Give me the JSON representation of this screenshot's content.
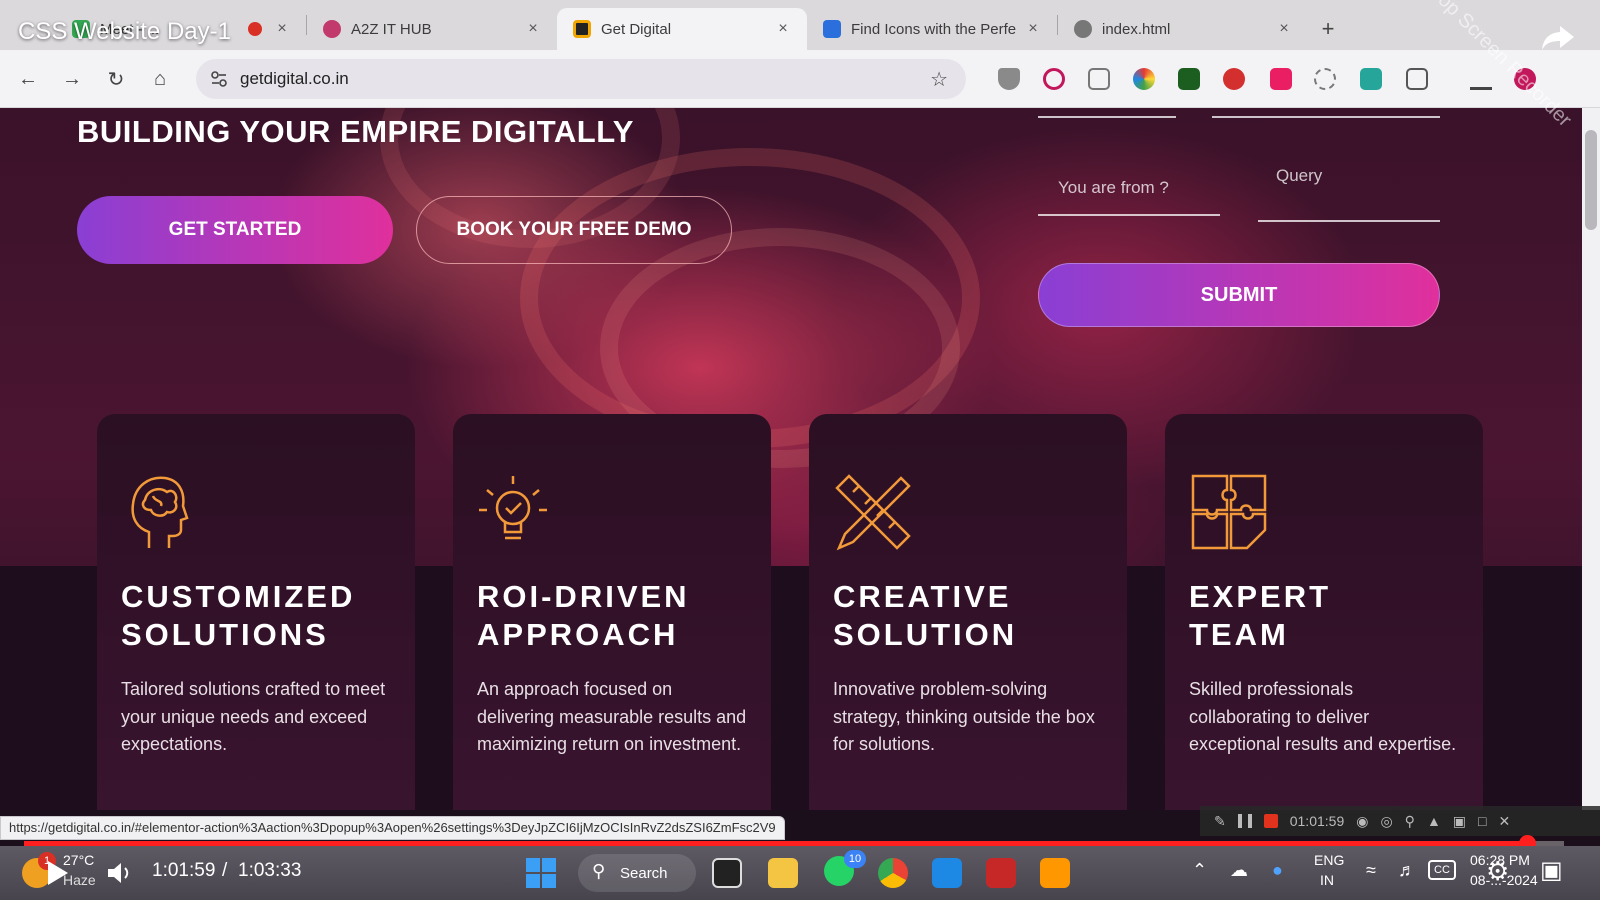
{
  "video": {
    "title": "CSS Website Day-1",
    "time_current": "1:01:59",
    "time_separator": "/",
    "time_total": "1:03:33",
    "progress_fraction": 0.976
  },
  "browser": {
    "tabs": [
      {
        "title": "Meet - ... ",
        "icon": "meet-icon",
        "active": false
      },
      {
        "title": "A2Z IT HUB",
        "icon": "a2z-icon",
        "active": false
      },
      {
        "title": "Get Digital",
        "icon": "getdigital-icon",
        "active": true
      },
      {
        "title": "Find Icons with the Perfe",
        "icon": "flag-icon",
        "active": false
      },
      {
        "title": "index.html",
        "icon": "globe-icon",
        "active": false
      }
    ],
    "tab_close": "×",
    "new_tab": "+",
    "url": "getdigital.co.in",
    "status_url": "https://getdigital.co.in/#elementor-action%3Aaction%3Dpopup%3Aopen%26settings%3DeyJpZCI6IjMzOCIsInRvZ2dsZSI6ZmFsc2V9"
  },
  "page": {
    "hero_heading": "BUILDING YOUR EMPIRE DIGITALLY",
    "cta_primary": "GET STARTED",
    "cta_secondary": "BOOK YOUR FREE DEMO",
    "form": {
      "from_placeholder": "You are from ?",
      "query_placeholder": "Query",
      "submit_label": "SUBMIT"
    },
    "cards": [
      {
        "title_line1": "CUSTOMIZED",
        "title_line2": "SOLUTIONS",
        "text": "Tailored solutions crafted to meet your unique needs and exceed expectations.",
        "icon": "brain-head-icon"
      },
      {
        "title_line1": "ROI-DRIVEN",
        "title_line2": "APPROACH",
        "text": "An approach focused on delivering measurable results and maximizing return on investment.",
        "icon": "lightbulb-check-icon"
      },
      {
        "title_line1": "CREATIVE",
        "title_line2": "SOLUTION",
        "text": "Innovative problem-solving strategy, thinking outside the box for solutions.",
        "icon": "pencil-ruler-icon"
      },
      {
        "title_line1": "EXPERT",
        "title_line2": "TEAM",
        "text": "Skilled professionals collaborating to deliver exceptional results and expertise.",
        "icon": "puzzle-icon"
      }
    ]
  },
  "recorder": {
    "timer": "01:01:59",
    "watermark": "iTop Screen Recorder"
  },
  "taskbar": {
    "weather_temp": "27°C",
    "weather_desc": "Haze",
    "weather_badge": "1",
    "search_label": "Search",
    "whatsapp_badge": "10",
    "lang_line1": "ENG",
    "lang_line2": "IN",
    "clock_time": "06:28 PM",
    "clock_date": "08-...-2024"
  },
  "colors": {
    "accent_gradient_start": "#8a3fd4",
    "accent_gradient_end": "#e0309c",
    "icon_orange": "#f29a3a",
    "progress_red": "#ff1f1f"
  }
}
